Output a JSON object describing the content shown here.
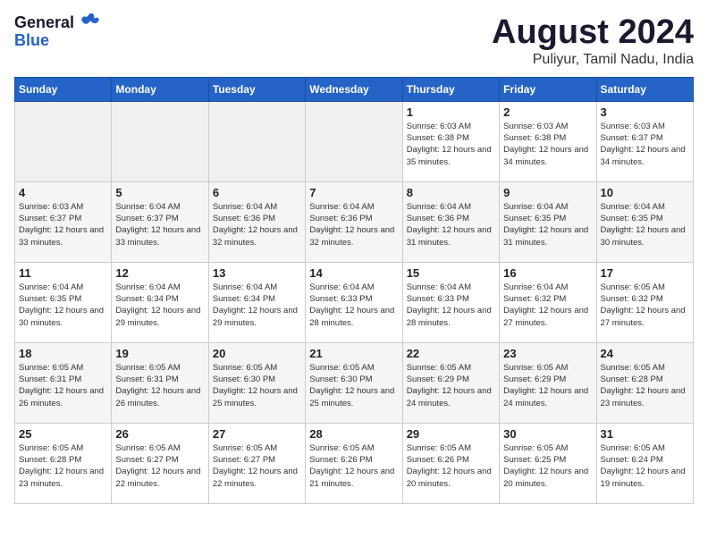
{
  "header": {
    "logo_general": "General",
    "logo_blue": "Blue",
    "month_title": "August 2024",
    "location": "Puliyur, Tamil Nadu, India"
  },
  "weekdays": [
    "Sunday",
    "Monday",
    "Tuesday",
    "Wednesday",
    "Thursday",
    "Friday",
    "Saturday"
  ],
  "weeks": [
    [
      {
        "day": "",
        "sunrise": "",
        "sunset": "",
        "daylight": ""
      },
      {
        "day": "",
        "sunrise": "",
        "sunset": "",
        "daylight": ""
      },
      {
        "day": "",
        "sunrise": "",
        "sunset": "",
        "daylight": ""
      },
      {
        "day": "",
        "sunrise": "",
        "sunset": "",
        "daylight": ""
      },
      {
        "day": "1",
        "sunrise": "Sunrise: 6:03 AM",
        "sunset": "Sunset: 6:38 PM",
        "daylight": "Daylight: 12 hours and 35 minutes."
      },
      {
        "day": "2",
        "sunrise": "Sunrise: 6:03 AM",
        "sunset": "Sunset: 6:38 PM",
        "daylight": "Daylight: 12 hours and 34 minutes."
      },
      {
        "day": "3",
        "sunrise": "Sunrise: 6:03 AM",
        "sunset": "Sunset: 6:37 PM",
        "daylight": "Daylight: 12 hours and 34 minutes."
      }
    ],
    [
      {
        "day": "4",
        "sunrise": "Sunrise: 6:03 AM",
        "sunset": "Sunset: 6:37 PM",
        "daylight": "Daylight: 12 hours and 33 minutes."
      },
      {
        "day": "5",
        "sunrise": "Sunrise: 6:04 AM",
        "sunset": "Sunset: 6:37 PM",
        "daylight": "Daylight: 12 hours and 33 minutes."
      },
      {
        "day": "6",
        "sunrise": "Sunrise: 6:04 AM",
        "sunset": "Sunset: 6:36 PM",
        "daylight": "Daylight: 12 hours and 32 minutes."
      },
      {
        "day": "7",
        "sunrise": "Sunrise: 6:04 AM",
        "sunset": "Sunset: 6:36 PM",
        "daylight": "Daylight: 12 hours and 32 minutes."
      },
      {
        "day": "8",
        "sunrise": "Sunrise: 6:04 AM",
        "sunset": "Sunset: 6:36 PM",
        "daylight": "Daylight: 12 hours and 31 minutes."
      },
      {
        "day": "9",
        "sunrise": "Sunrise: 6:04 AM",
        "sunset": "Sunset: 6:35 PM",
        "daylight": "Daylight: 12 hours and 31 minutes."
      },
      {
        "day": "10",
        "sunrise": "Sunrise: 6:04 AM",
        "sunset": "Sunset: 6:35 PM",
        "daylight": "Daylight: 12 hours and 30 minutes."
      }
    ],
    [
      {
        "day": "11",
        "sunrise": "Sunrise: 6:04 AM",
        "sunset": "Sunset: 6:35 PM",
        "daylight": "Daylight: 12 hours and 30 minutes."
      },
      {
        "day": "12",
        "sunrise": "Sunrise: 6:04 AM",
        "sunset": "Sunset: 6:34 PM",
        "daylight": "Daylight: 12 hours and 29 minutes."
      },
      {
        "day": "13",
        "sunrise": "Sunrise: 6:04 AM",
        "sunset": "Sunset: 6:34 PM",
        "daylight": "Daylight: 12 hours and 29 minutes."
      },
      {
        "day": "14",
        "sunrise": "Sunrise: 6:04 AM",
        "sunset": "Sunset: 6:33 PM",
        "daylight": "Daylight: 12 hours and 28 minutes."
      },
      {
        "day": "15",
        "sunrise": "Sunrise: 6:04 AM",
        "sunset": "Sunset: 6:33 PM",
        "daylight": "Daylight: 12 hours and 28 minutes."
      },
      {
        "day": "16",
        "sunrise": "Sunrise: 6:04 AM",
        "sunset": "Sunset: 6:32 PM",
        "daylight": "Daylight: 12 hours and 27 minutes."
      },
      {
        "day": "17",
        "sunrise": "Sunrise: 6:05 AM",
        "sunset": "Sunset: 6:32 PM",
        "daylight": "Daylight: 12 hours and 27 minutes."
      }
    ],
    [
      {
        "day": "18",
        "sunrise": "Sunrise: 6:05 AM",
        "sunset": "Sunset: 6:31 PM",
        "daylight": "Daylight: 12 hours and 26 minutes."
      },
      {
        "day": "19",
        "sunrise": "Sunrise: 6:05 AM",
        "sunset": "Sunset: 6:31 PM",
        "daylight": "Daylight: 12 hours and 26 minutes."
      },
      {
        "day": "20",
        "sunrise": "Sunrise: 6:05 AM",
        "sunset": "Sunset: 6:30 PM",
        "daylight": "Daylight: 12 hours and 25 minutes."
      },
      {
        "day": "21",
        "sunrise": "Sunrise: 6:05 AM",
        "sunset": "Sunset: 6:30 PM",
        "daylight": "Daylight: 12 hours and 25 minutes."
      },
      {
        "day": "22",
        "sunrise": "Sunrise: 6:05 AM",
        "sunset": "Sunset: 6:29 PM",
        "daylight": "Daylight: 12 hours and 24 minutes."
      },
      {
        "day": "23",
        "sunrise": "Sunrise: 6:05 AM",
        "sunset": "Sunset: 6:29 PM",
        "daylight": "Daylight: 12 hours and 24 minutes."
      },
      {
        "day": "24",
        "sunrise": "Sunrise: 6:05 AM",
        "sunset": "Sunset: 6:28 PM",
        "daylight": "Daylight: 12 hours and 23 minutes."
      }
    ],
    [
      {
        "day": "25",
        "sunrise": "Sunrise: 6:05 AM",
        "sunset": "Sunset: 6:28 PM",
        "daylight": "Daylight: 12 hours and 23 minutes."
      },
      {
        "day": "26",
        "sunrise": "Sunrise: 6:05 AM",
        "sunset": "Sunset: 6:27 PM",
        "daylight": "Daylight: 12 hours and 22 minutes."
      },
      {
        "day": "27",
        "sunrise": "Sunrise: 6:05 AM",
        "sunset": "Sunset: 6:27 PM",
        "daylight": "Daylight: 12 hours and 22 minutes."
      },
      {
        "day": "28",
        "sunrise": "Sunrise: 6:05 AM",
        "sunset": "Sunset: 6:26 PM",
        "daylight": "Daylight: 12 hours and 21 minutes."
      },
      {
        "day": "29",
        "sunrise": "Sunrise: 6:05 AM",
        "sunset": "Sunset: 6:26 PM",
        "daylight": "Daylight: 12 hours and 20 minutes."
      },
      {
        "day": "30",
        "sunrise": "Sunrise: 6:05 AM",
        "sunset": "Sunset: 6:25 PM",
        "daylight": "Daylight: 12 hours and 20 minutes."
      },
      {
        "day": "31",
        "sunrise": "Sunrise: 6:05 AM",
        "sunset": "Sunset: 6:24 PM",
        "daylight": "Daylight: 12 hours and 19 minutes."
      }
    ]
  ]
}
